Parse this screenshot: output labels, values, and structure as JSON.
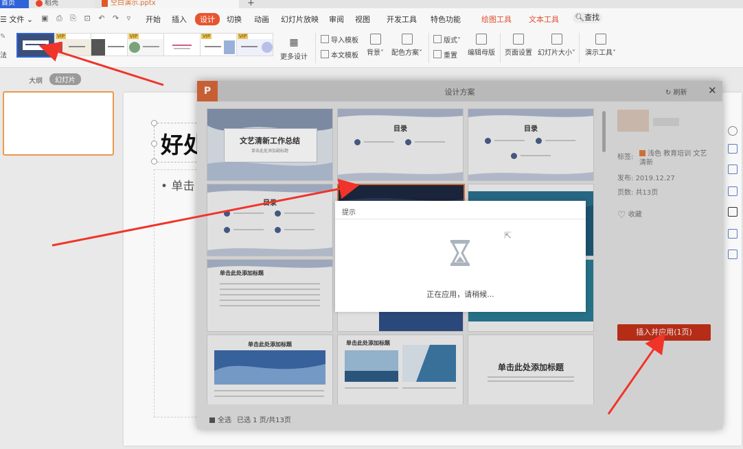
{
  "tabs": {
    "home": "首页",
    "daoke": "稻壳",
    "file": "空白演示.pptx"
  },
  "menu": {
    "file": "文件",
    "items": [
      "开始",
      "插入",
      "设计",
      "切换",
      "动画",
      "幻灯片放映",
      "审阅",
      "视图",
      "开发工具",
      "特色功能"
    ],
    "active": "设计",
    "drawing_tools": "绘图工具",
    "text_tools": "文本工具",
    "search": "查找"
  },
  "ribbon": {
    "left_cut": "法",
    "vip_badge": "VIP",
    "more_design": "更多设计",
    "import_template": "导入模板",
    "text_template": "本文模板",
    "background": "背景",
    "color_scheme": "配色方案",
    "layout": "版式",
    "reset": "重置",
    "edit_master": "编辑母版",
    "page_setup": "页面设置",
    "slide_size": "幻灯片大小",
    "presenter_tools": "演示工具"
  },
  "left_panel": {
    "outline": "大纲",
    "slides": "幻灯片"
  },
  "slide": {
    "title_partial": "好处",
    "bullet_partial": "单击"
  },
  "dialog": {
    "logo": "P",
    "title": "设计方案",
    "refresh": "刷新",
    "close": "✕",
    "cards": [
      {
        "title": "文艺清新工作总结",
        "subtitle": "单击此处添加副标题"
      },
      {
        "title": "目录"
      },
      {
        "title": "目录"
      },
      {
        "title": "目录"
      },
      {
        "title": ""
      },
      {
        "title": ""
      },
      {
        "title": "单击此处添加标题"
      },
      {
        "title": ""
      },
      {
        "title": ""
      },
      {
        "title": "单击此处添加标题"
      },
      {
        "title": "单击此处添加标题"
      },
      {
        "title": "单击此处添加标题"
      }
    ],
    "tag_label": "标签:",
    "tag_values": "浅色 教育培训 文艺清新",
    "publish_label": "发布:",
    "publish_date": "2019.12.27",
    "pages_label": "页数:",
    "pages_value": "共13页",
    "favorite": "收藏",
    "apply_button": "插入并应用(1页)",
    "select_all": "全选",
    "selected_count": "已选 1 页/共13页"
  },
  "hint": {
    "title": "提示",
    "message": "正在应用，请稍候..."
  },
  "colors": {
    "accent_orange": "#e8542f",
    "apply_red": "#c5301a",
    "arrow_red": "#f0342a"
  }
}
